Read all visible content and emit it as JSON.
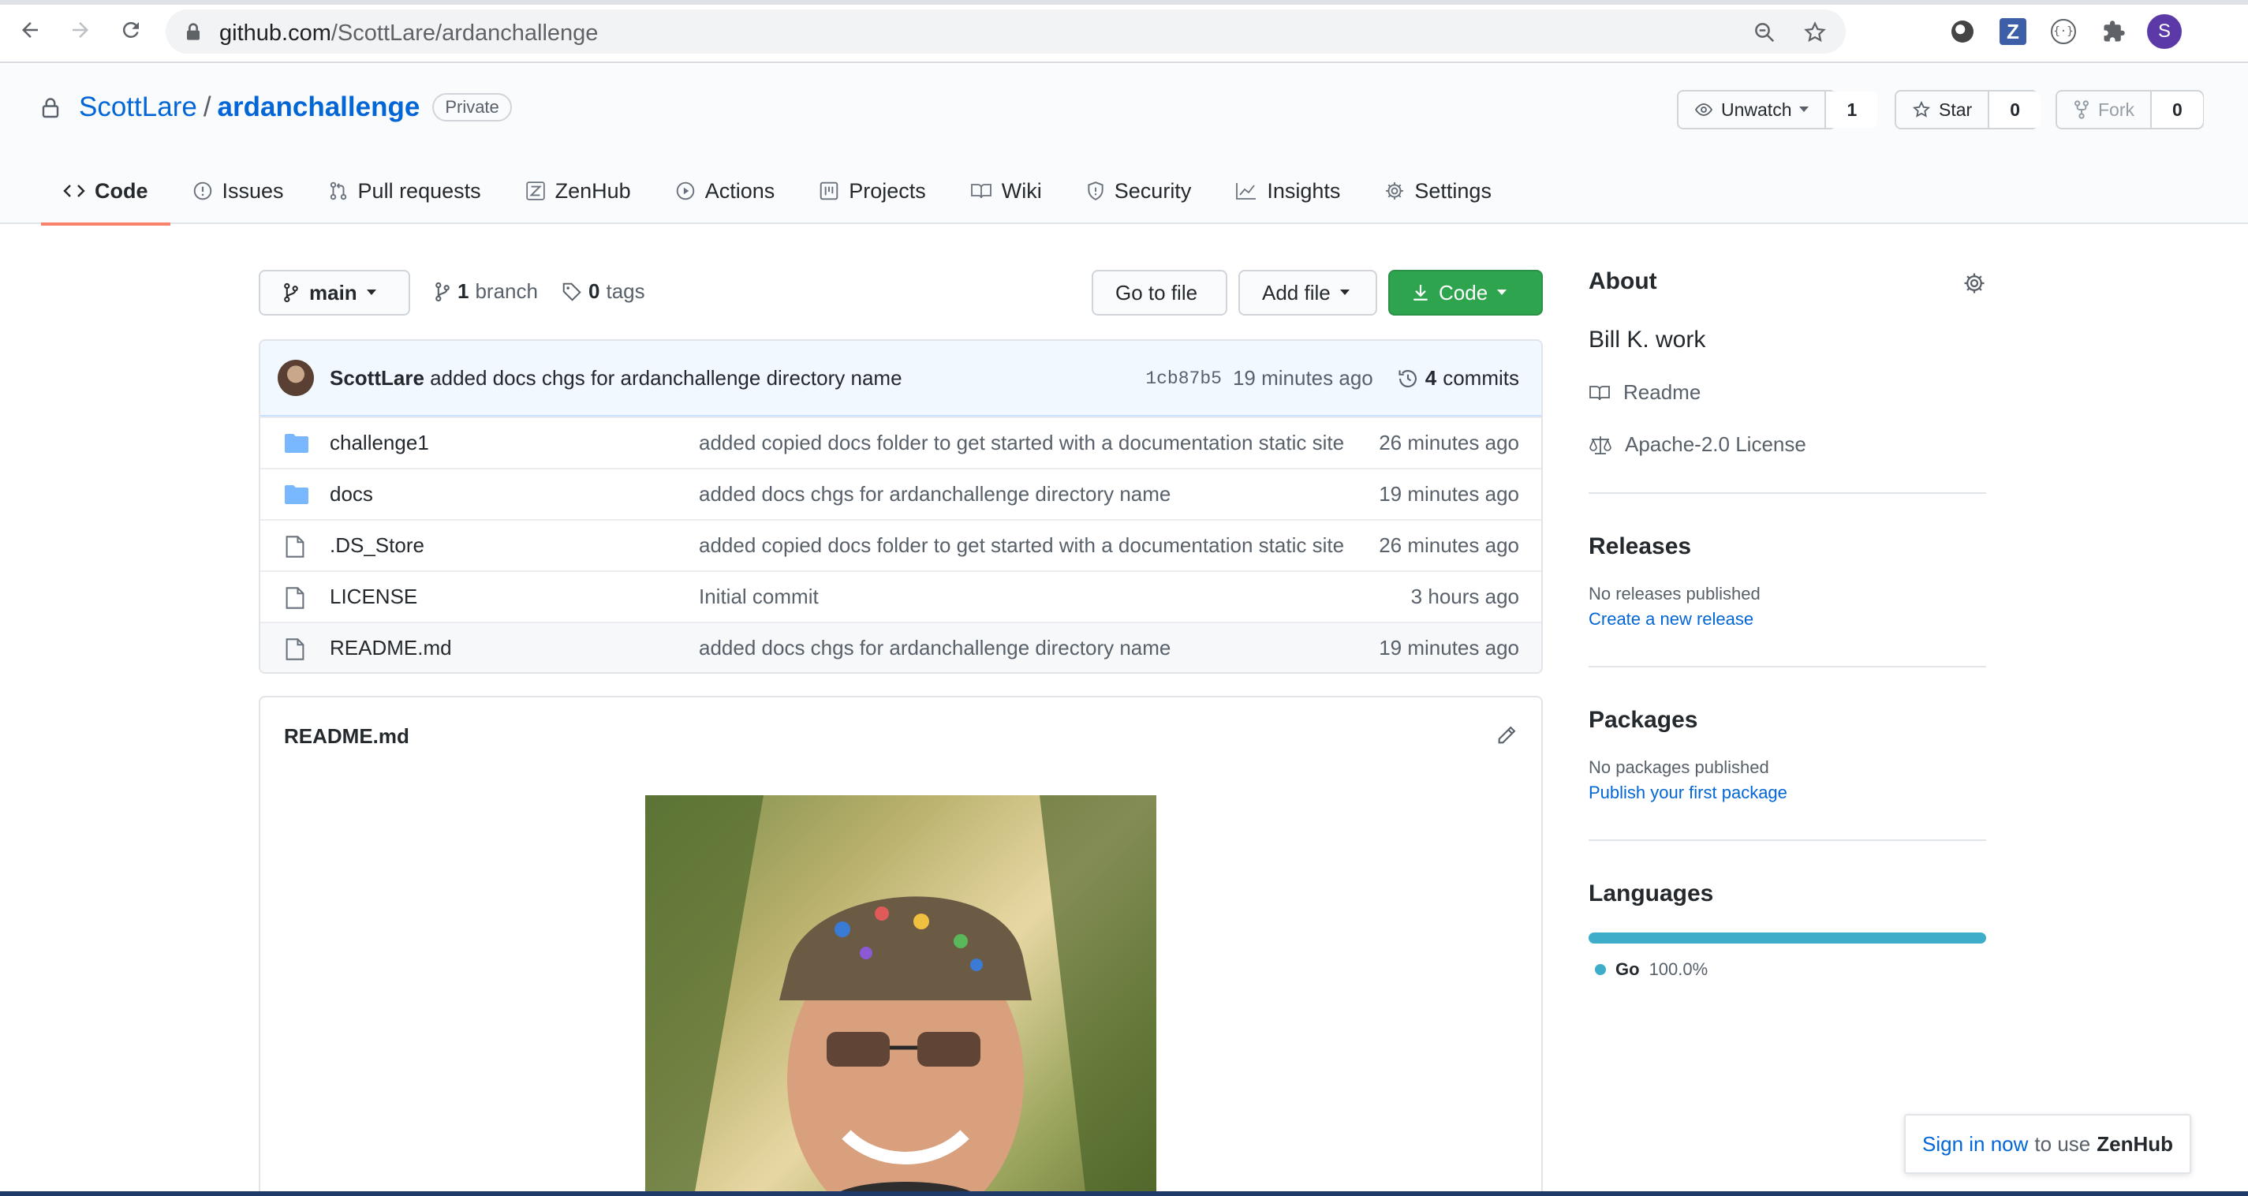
{
  "browser": {
    "url_host": "github.com",
    "url_path": "/ScottLare/ardanchallenge",
    "profile_initial": "S",
    "extension_z": "Z"
  },
  "repo": {
    "owner": "ScottLare",
    "separator": "/",
    "name": "ardanchallenge",
    "visibility": "Private",
    "watch_label": "Unwatch",
    "watch_count": "1",
    "star_label": "Star",
    "star_count": "0",
    "fork_label": "Fork",
    "fork_count": "0"
  },
  "tabs": [
    {
      "label": "Code",
      "icon": "code-icon"
    },
    {
      "label": "Issues",
      "icon": "issue-icon"
    },
    {
      "label": "Pull requests",
      "icon": "pull-request-icon"
    },
    {
      "label": "ZenHub",
      "icon": "zenhub-icon"
    },
    {
      "label": "Actions",
      "icon": "play-icon"
    },
    {
      "label": "Projects",
      "icon": "project-icon"
    },
    {
      "label": "Wiki",
      "icon": "book-icon"
    },
    {
      "label": "Security",
      "icon": "shield-icon"
    },
    {
      "label": "Insights",
      "icon": "graph-icon"
    },
    {
      "label": "Settings",
      "icon": "gear-icon"
    }
  ],
  "toolbar": {
    "branch": "main",
    "branch_count": "1",
    "branch_word": "branch",
    "tag_count": "0",
    "tag_word": "tags",
    "go_to_file": "Go to file",
    "add_file": "Add file",
    "code": "Code"
  },
  "latest_commit": {
    "author": "ScottLare",
    "message": "added docs chgs for ardanchallenge directory name",
    "sha": "1cb87b5",
    "age": "19 minutes ago",
    "commit_count": "4",
    "commit_word": "commits"
  },
  "files": [
    {
      "type": "dir",
      "name": "challenge1",
      "message": "added copied docs folder to get started with a documentation static site",
      "age": "26 minutes ago"
    },
    {
      "type": "dir",
      "name": "docs",
      "message": "added docs chgs for ardanchallenge directory name",
      "age": "19 minutes ago"
    },
    {
      "type": "file",
      "name": ".DS_Store",
      "message": "added copied docs folder to get started with a documentation static site",
      "age": "26 minutes ago"
    },
    {
      "type": "file",
      "name": "LICENSE",
      "message": "Initial commit",
      "age": "3 hours ago"
    },
    {
      "type": "file",
      "name": "README.md",
      "message": "added docs chgs for ardanchallenge directory name",
      "age": "19 minutes ago"
    }
  ],
  "readme": {
    "title": "README.md"
  },
  "about": {
    "heading": "About",
    "description": "Bill K. work",
    "readme_link": "Readme",
    "license_link": "Apache-2.0 License"
  },
  "releases": {
    "heading": "Releases",
    "empty": "No releases published",
    "create_link": "Create a new release"
  },
  "packages": {
    "heading": "Packages",
    "empty": "No packages published",
    "publish_link": "Publish your first package"
  },
  "languages": {
    "heading": "Languages",
    "items": [
      {
        "name": "Go",
        "percent": "100.0%",
        "share": 1.0,
        "color": "#3dadc9"
      }
    ]
  },
  "zenhub_toast": {
    "signin": "Sign in now",
    "middle": "to use",
    "brand": "ZenHub"
  },
  "colors": {
    "link": "#0366d6",
    "primary_button": "#2ea44f",
    "active_tab_underline": "#f9826c"
  }
}
